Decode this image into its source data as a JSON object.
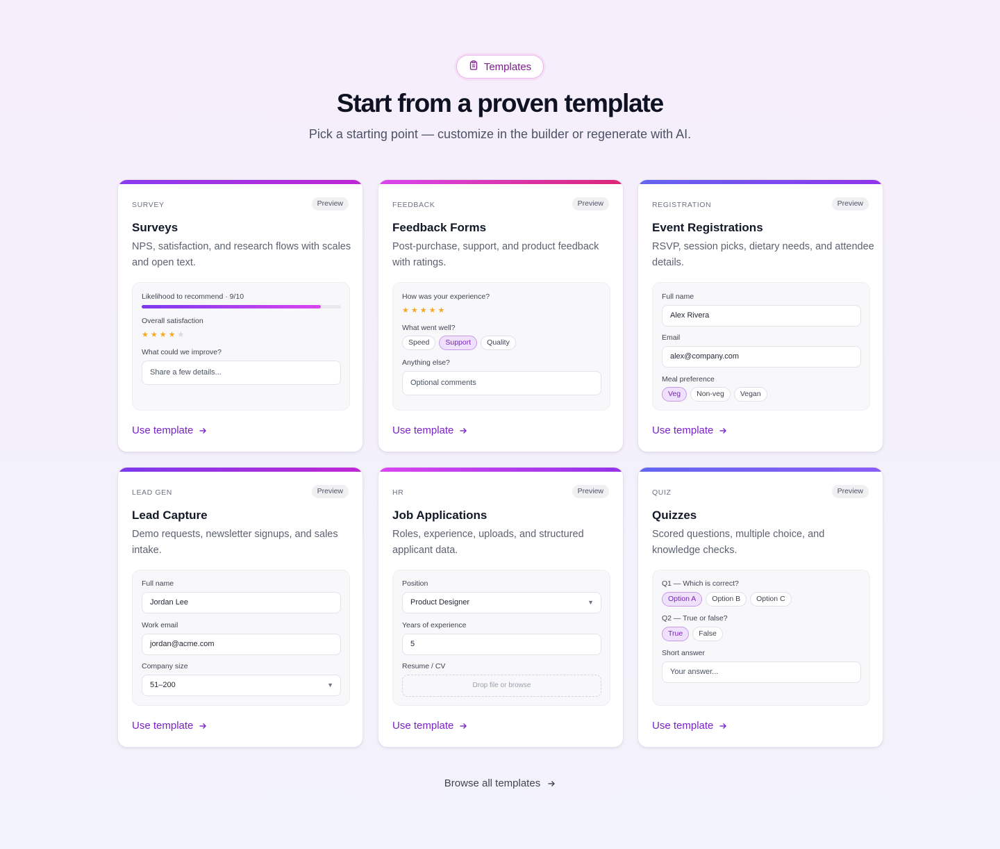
{
  "header": {
    "pill_label": "Templates",
    "pill_icon": "clipboard-icon",
    "headline": "Start from a proven template",
    "subhead": "Pick a starting point — customize in the builder or regenerate with AI."
  },
  "colors": {
    "accent": "#7a22c7",
    "survey_bar": [
      "#8b3cf0",
      "#c026d3"
    ],
    "feedback_bar": [
      "#d946ef",
      "#db2777"
    ],
    "registration_bar": [
      "#6366f1",
      "#9333ea"
    ],
    "lead_bar": [
      "#7c3aed",
      "#c026d3"
    ],
    "hr_bar": [
      "#d946ef",
      "#9333ea"
    ],
    "quiz_bar": [
      "#6366f1",
      "#8b5cf6"
    ]
  },
  "cards": [
    {
      "eyebrow": "SURVEY",
      "badge": "Preview",
      "title": "Surveys",
      "desc": "NPS, satisfaction, and research flows with scales and open text.",
      "preview": {
        "label1": "Likelihood to recommend · 9/10",
        "progress": 0.9,
        "label2": "Overall satisfaction",
        "rating": 4,
        "label3": "What could we improve?",
        "placeholder": "Share a few details..."
      },
      "cta": "Use template"
    },
    {
      "eyebrow": "FEEDBACK",
      "badge": "Preview",
      "title": "Feedback Forms",
      "desc": "Post-purchase, support, and product feedback with ratings.",
      "preview": {
        "label1": "How was your experience?",
        "rating": 5,
        "label2": "What went well?",
        "chips": [
          "Speed",
          "Support",
          "Quality"
        ],
        "selected": "Support",
        "label3": "Anything else?",
        "placeholder": "Optional comments"
      },
      "cta": "Use template"
    },
    {
      "eyebrow": "REGISTRATION",
      "badge": "Preview",
      "title": "Event Registrations",
      "desc": "RSVP, session picks, dietary needs, and attendee details.",
      "preview": {
        "label1": "Full name",
        "value1": "Alex Rivera",
        "label2": "Email",
        "value2": "alex@company.com",
        "label3": "Meal preference",
        "chips": [
          "Veg",
          "Non-veg",
          "Vegan"
        ],
        "selected": "Veg"
      },
      "cta": "Use template"
    },
    {
      "eyebrow": "LEAD GEN",
      "badge": "Preview",
      "title": "Lead Capture",
      "desc": "Demo requests, newsletter signups, and sales intake.",
      "preview": {
        "label1": "Full name",
        "value1": "Jordan Lee",
        "label2": "Work email",
        "value2": "jordan@acme.com",
        "label3": "Company size",
        "value3": "51–200"
      },
      "cta": "Use template"
    },
    {
      "eyebrow": "HR",
      "badge": "Preview",
      "title": "Job Applications",
      "desc": "Roles, experience, uploads, and structured applicant data.",
      "preview": {
        "label1": "Position",
        "value1": "Product Designer",
        "label2": "Years of experience",
        "value2": "5",
        "label3": "Resume / CV",
        "drop_text": "Drop file or browse"
      },
      "cta": "Use template"
    },
    {
      "eyebrow": "QUIZ",
      "badge": "Preview",
      "title": "Quizzes",
      "desc": "Scored questions, multiple choice, and knowledge checks.",
      "preview": {
        "label1": "Q1 — Which is correct?",
        "chips1": [
          "Option A",
          "Option B",
          "Option C"
        ],
        "selected1": "Option A",
        "label2": "Q2 — True or false?",
        "chips2": [
          "True",
          "False"
        ],
        "selected2": "True",
        "label3": "Short answer",
        "placeholder": "Your answer..."
      },
      "cta": "Use template"
    }
  ],
  "footer": {
    "browse_label": "Browse all templates"
  }
}
